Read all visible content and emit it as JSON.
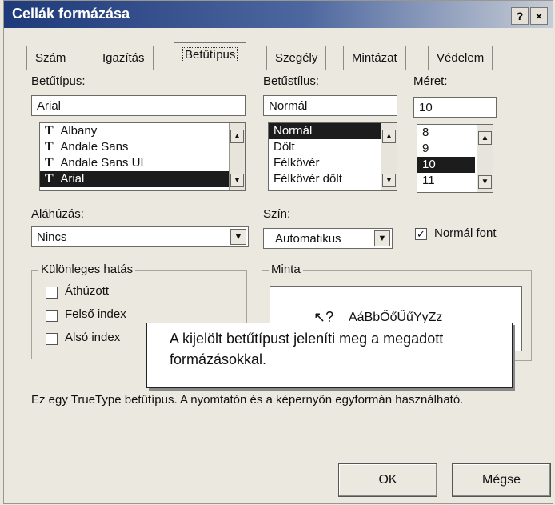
{
  "titlebar": {
    "title": "Cellák formázása",
    "help": "?",
    "close": "×"
  },
  "tabs": [
    "Szám",
    "Igazítás",
    "Betűtípus",
    "Szegély",
    "Mintázat",
    "Védelem"
  ],
  "font": {
    "label": "Betűtípus:",
    "value": "Arial",
    "items": [
      "Albany",
      "Andale Sans",
      "Andale Sans UI",
      "Arial"
    ],
    "selected": "Arial",
    "icon": "truetype-icon"
  },
  "style": {
    "label": "Betűstílus:",
    "value": "Normál",
    "items": [
      "Normál",
      "Dőlt",
      "Félkövér",
      "Félkövér dőlt"
    ],
    "selected": "Normál"
  },
  "size": {
    "label": "Méret:",
    "value": "10",
    "items": [
      "8",
      "9",
      "10",
      "11"
    ],
    "selected": "10"
  },
  "underline": {
    "label": "Aláhúzás:",
    "value": "Nincs"
  },
  "color": {
    "label": "Szín:",
    "value": "Automatikus"
  },
  "normal_font": {
    "label": "Normál font",
    "checked": true
  },
  "effects": {
    "legend": "Különleges hatás",
    "items": [
      {
        "label": "Áthúzott",
        "checked": false
      },
      {
        "label": "Felső index",
        "checked": false
      },
      {
        "label": "Alsó index",
        "checked": false
      }
    ]
  },
  "preview": {
    "legend": "Minta",
    "sample": "AáBbŐőŰűYyZz"
  },
  "tooltip": {
    "text": "A kijelölt betűtípust jeleníti meg a megadott formázásokkal."
  },
  "description": "Ez egy TrueType betűtípus. A nyomtatón és a képernyőn egyformán használható.",
  "buttons": {
    "ok": "OK",
    "cancel": "Mégse"
  }
}
